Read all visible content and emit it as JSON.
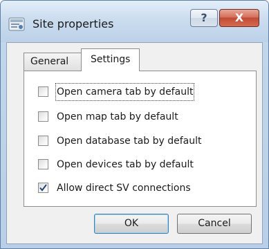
{
  "window": {
    "title": "Site properties",
    "help_label": "?",
    "close_label": "X"
  },
  "tabs": [
    {
      "label": "General",
      "selected": false
    },
    {
      "label": "Settings",
      "selected": true
    }
  ],
  "settings": {
    "options": [
      {
        "label": "Open camera tab by default",
        "checked": false
      },
      {
        "label": "Open map tab by default",
        "checked": false
      },
      {
        "label": "Open database tab by default",
        "checked": false
      },
      {
        "label": "Open devices tab by default",
        "checked": false
      },
      {
        "label": "Allow direct SV connections",
        "checked": true
      }
    ]
  },
  "buttons": {
    "ok_label": "OK",
    "cancel_label": "Cancel"
  },
  "colors": {
    "title_accent": "#bcd1e8",
    "close_button": "#c24a33",
    "check_mark": "#24466f"
  }
}
